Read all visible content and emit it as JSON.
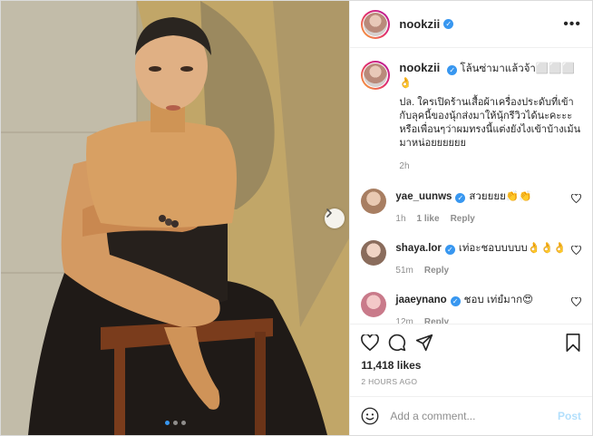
{
  "post": {
    "username": "nookzii",
    "verified": true,
    "caption_first": "โล้นซ่ามาแล้วจ้า⬜⬜⬜👌",
    "caption_body": "ปล. ใครเปิดร้านเสื้อผ้าเครื่องประดับที่เข้ากับลุคนี้ของนุ้กส่งมาให้นุ้กรีวิวได้นะคะะะ หรือเพื่อนๆว่าผมทรงนี้แต่งยังไงเข้าบ้างเม้นมาหน่อยยยยยย",
    "caption_time": "2h",
    "likes": "11,418 likes",
    "time_ago": "2 HOURS AGO",
    "carousel_dots": 3,
    "active_dot": 0
  },
  "comments": [
    {
      "username": "yae_uunws",
      "text": "สวยยยย👏👏",
      "time": "1h",
      "likes": "1 like",
      "reply": "Reply",
      "avatar_color": "#c9a58a"
    },
    {
      "username": "shaya.lor",
      "text": "เท่อะชอบบบบบ👌👌👌",
      "time": "51m",
      "reply": "Reply",
      "avatar_color": "#d9b7a8"
    },
    {
      "username": "jaaeynano",
      "text": "ชอบ เท่ยํมาก😍",
      "time": "12m",
      "reply": "Reply",
      "avatar_color": "#e6a3b0"
    }
  ],
  "add_comment": {
    "placeholder": "Add a comment...",
    "post_label": "Post"
  },
  "icons": {
    "next": "chevron-right-icon",
    "heart": "heart-icon",
    "comment": "comment-icon",
    "share": "paper-plane-icon",
    "save": "bookmark-icon",
    "emoji": "smiley-icon",
    "more": "more-horizontal-icon"
  },
  "colors": {
    "link_blue": "#3897f0",
    "post_disabled": "#b2dffc",
    "meta_gray": "#8e8e8e"
  }
}
